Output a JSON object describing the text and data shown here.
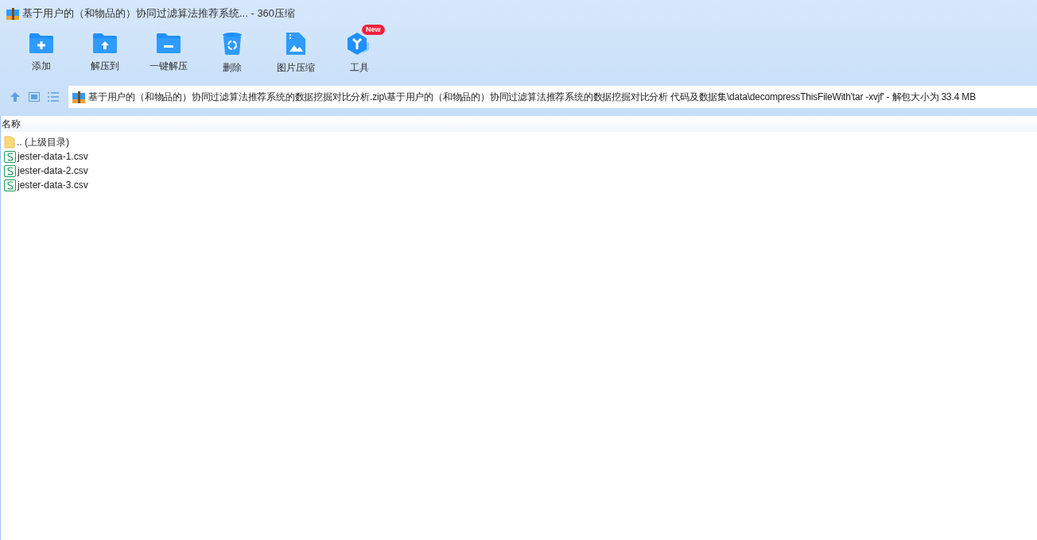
{
  "window": {
    "title": "基于用户的（和物品的）协同过滤算法推荐系统... - 360压缩"
  },
  "toolbar": [
    {
      "kind": "add",
      "label": "添加"
    },
    {
      "kind": "extract-to",
      "label": "解压到"
    },
    {
      "kind": "extract",
      "label": "一键解压"
    },
    {
      "kind": "delete",
      "label": "删除"
    },
    {
      "kind": "image",
      "label": "图片压缩"
    },
    {
      "kind": "tools",
      "label": "工具",
      "badge": "New"
    }
  ],
  "path": "基于用户的（和物品的）协同过滤算法推荐系统的数据挖掘对比分析.zip\\基于用户的（和物品的）协同过滤算法推荐系统的数据挖掘对比分析 代码及数据集\\data\\decompressThisFileWith'tar -xvjf' - 解包大小为 33.4 MB",
  "table": {
    "columns": [
      "名称"
    ],
    "rows": [
      {
        "kind": "folder",
        "name": ".. (上级目录)"
      },
      {
        "kind": "csv",
        "name": "jester-data-1.csv"
      },
      {
        "kind": "csv",
        "name": "jester-data-2.csv"
      },
      {
        "kind": "csv",
        "name": "jester-data-3.csv"
      }
    ]
  }
}
